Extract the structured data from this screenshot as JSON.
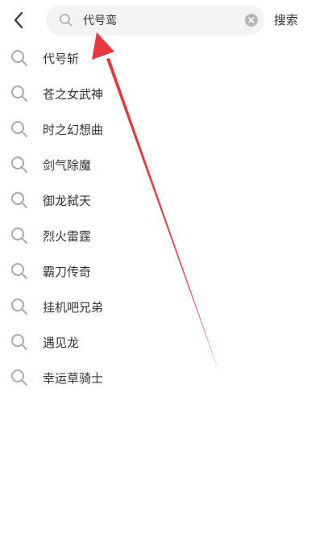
{
  "header": {
    "back_icon": "chevron-left-icon",
    "search": {
      "value": "代号鸾",
      "icon": "search-icon",
      "clear_icon": "clear-circle-icon"
    },
    "search_button_label": "搜索"
  },
  "suggestions": [
    {
      "label": "代号斩"
    },
    {
      "label": "苍之女武神"
    },
    {
      "label": "时之幻想曲"
    },
    {
      "label": "剑气除魔"
    },
    {
      "label": "御龙弑天"
    },
    {
      "label": "烈火雷霆"
    },
    {
      "label": "霸刀传奇"
    },
    {
      "label": "挂机吧兄弟"
    },
    {
      "label": "遇见龙"
    },
    {
      "label": "幸运草骑士"
    }
  ],
  "colors": {
    "search_bg": "#f2f3f5",
    "text": "#333333",
    "icon_gray": "#a9a9a9",
    "annotation_arrow": "#e8383d"
  }
}
